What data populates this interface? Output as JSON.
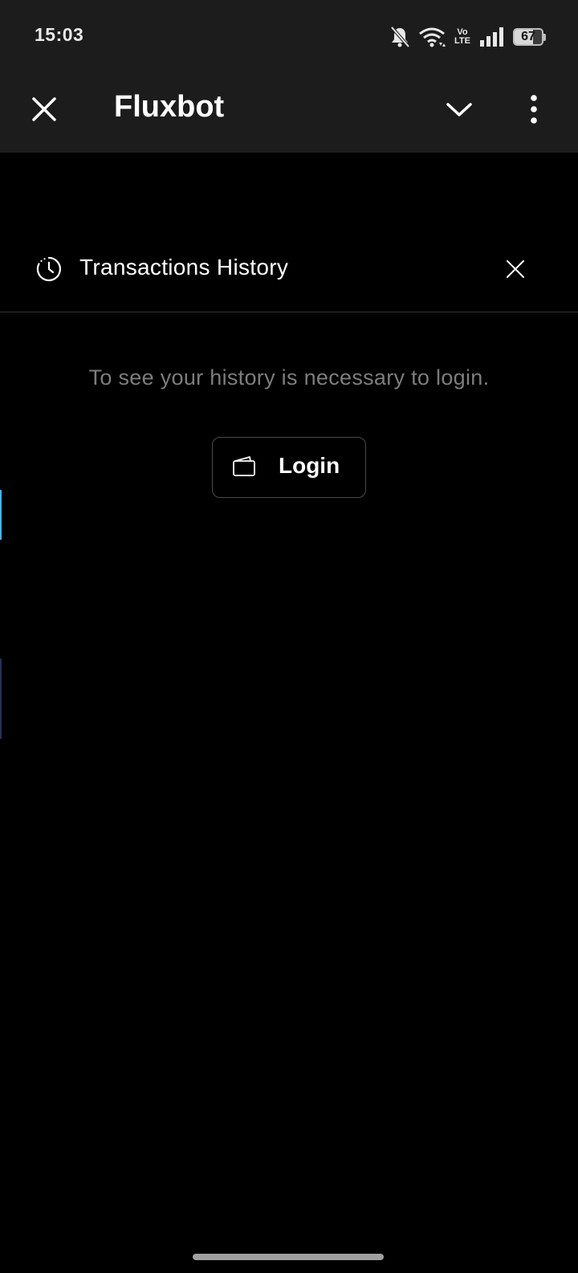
{
  "status_bar": {
    "time": "15:03",
    "volte_top": "Vo",
    "volte_bottom": "LTE",
    "battery_level": "67",
    "battery_fraction": 0.67,
    "icons": [
      "bell-off-icon",
      "wifi-icon",
      "volte-icon",
      "signal-icon",
      "battery-icon"
    ]
  },
  "app_bar": {
    "title": "Fluxbot",
    "icons": [
      "close-icon",
      "chevron-down-icon",
      "more-vertical-icon"
    ]
  },
  "panel": {
    "title": "Transactions History",
    "icons": [
      "history-icon",
      "close-icon"
    ]
  },
  "message": "To see your history is necessary to login.",
  "login_button": {
    "label": "Login",
    "icon": "wallet-icon"
  },
  "colors": {
    "background": "#000000",
    "bar_background": "#1c1c1c",
    "muted_text": "#7d7d7d",
    "accent": "#38b8ff"
  }
}
